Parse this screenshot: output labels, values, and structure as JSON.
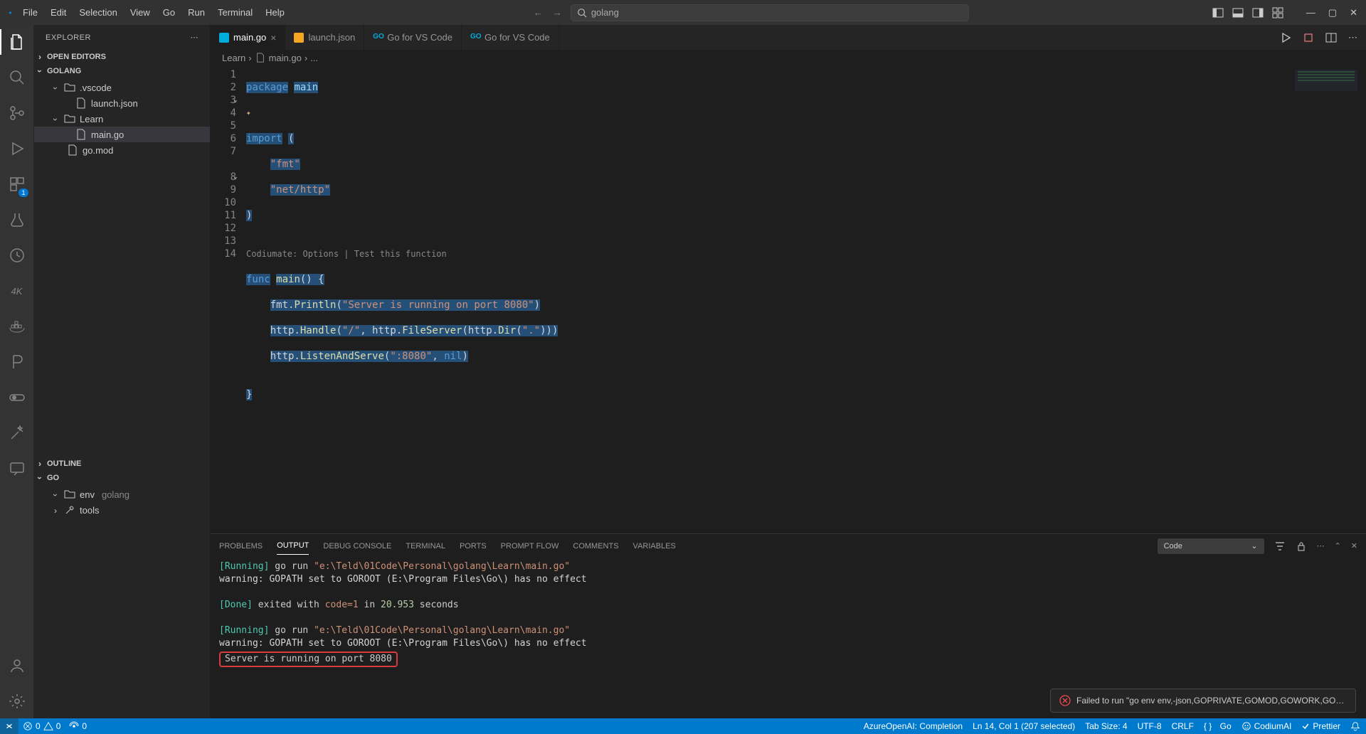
{
  "menu": [
    "File",
    "Edit",
    "Selection",
    "View",
    "Go",
    "Run",
    "Terminal",
    "Help"
  ],
  "search": {
    "placeholder": "golang"
  },
  "explorer": {
    "title": "EXPLORER",
    "sections": {
      "openEditors": "OPEN EDITORS",
      "workspace": "GOLANG",
      "outline": "OUTLINE",
      "go": "GO"
    },
    "tree": {
      "vscode": ".vscode",
      "launch": "launch.json",
      "learn": "Learn",
      "main": "main.go",
      "gomod": "go.mod",
      "env": "env",
      "envSuffix": "golang",
      "tools": "tools"
    }
  },
  "tabs": [
    {
      "label": "main.go",
      "icon": "go",
      "active": true,
      "close": true
    },
    {
      "label": "launch.json",
      "icon": "json",
      "active": false,
      "close": false
    },
    {
      "label": "Go for VS Code",
      "icon": "go-ext",
      "active": false,
      "close": false
    },
    {
      "label": "Go for VS Code",
      "icon": "go-ext",
      "active": false,
      "close": false
    }
  ],
  "breadcrumb": {
    "root": "Learn",
    "file": "main.go",
    "more": "..."
  },
  "code": {
    "lines": [
      "1",
      "2",
      "3",
      "4",
      "5",
      "6",
      "7",
      "",
      "8",
      "9",
      "10",
      "11",
      "12",
      "13",
      "14"
    ],
    "l1_kw": "package",
    "l1_id": "main",
    "l3_kw": "import",
    "l3_paren": "(",
    "l4_str": "\"fmt\"",
    "l5_str": "\"net/http\"",
    "l6": ")",
    "hint": "Codiumate: Options | Test this function",
    "l8_kw": "func",
    "l8_fn": "main",
    "l8_rest": "() {",
    "l9_a": "fmt.",
    "l9_fn": "Println",
    "l9_p": "(",
    "l9_str": "\"Server is running on port 8080\"",
    "l9_c": ")",
    "l10_a": "http.",
    "l10_fn": "Handle",
    "l10_p": "(",
    "l10_str": "\"/\"",
    "l10_c": ", http.",
    "l10_fn2": "FileServer",
    "l10_p2": "(http.",
    "l10_fn3": "Dir",
    "l10_p3": "(",
    "l10_str2": "\".\"",
    "l10_end": ")))",
    "l11_a": "http.",
    "l11_fn": "ListenAndServe",
    "l11_p": "(",
    "l11_str": "\":8080\"",
    "l11_c": ", ",
    "l11_nil": "nil",
    "l11_end": ")",
    "l12": "",
    "l13": "}"
  },
  "panel": {
    "tabs": [
      "PROBLEMS",
      "OUTPUT",
      "DEBUG CONSOLE",
      "TERMINAL",
      "PORTS",
      "PROMPT FLOW",
      "COMMENTS",
      "VARIABLES"
    ],
    "activeTab": "OUTPUT",
    "selector": "Code",
    "output": {
      "run1_tag": "[Running]",
      "run1_cmd": " go run ",
      "run1_path": "\"e:\\Teld\\01Code\\Personal\\golang\\Learn\\main.go\"",
      "warn1": "warning: GOPATH set to GOROOT (E:\\Program Files\\Go\\) has no effect",
      "done_tag": "[Done]",
      "done_txt": " exited with ",
      "done_code": "code=1",
      "done_in": " in ",
      "done_sec": "20.953",
      "done_suffix": " seconds",
      "run2_tag": "[Running]",
      "run2_cmd": " go run ",
      "run2_path": "\"e:\\Teld\\01Code\\Personal\\golang\\Learn\\main.go\"",
      "warn2": "warning: GOPATH set to GOROOT (E:\\Program Files\\Go\\) has no effect",
      "server": "Server is running on port 8080"
    }
  },
  "toast": {
    "text": "Failed to run \"go env env,-json,GOPRIVATE,GOMOD,GOWORK,GOENV,..."
  },
  "status": {
    "errors": "0",
    "warnings": "0",
    "ports": "0",
    "ai": "AzureOpenAI: Completion",
    "sel": "Ln 14, Col 1 (207 selected)",
    "tab": "Tab Size: 4",
    "enc": "UTF-8",
    "eol": "CRLF",
    "lang": "Go",
    "codium": "CodiumAI",
    "prettier": "Prettier"
  }
}
